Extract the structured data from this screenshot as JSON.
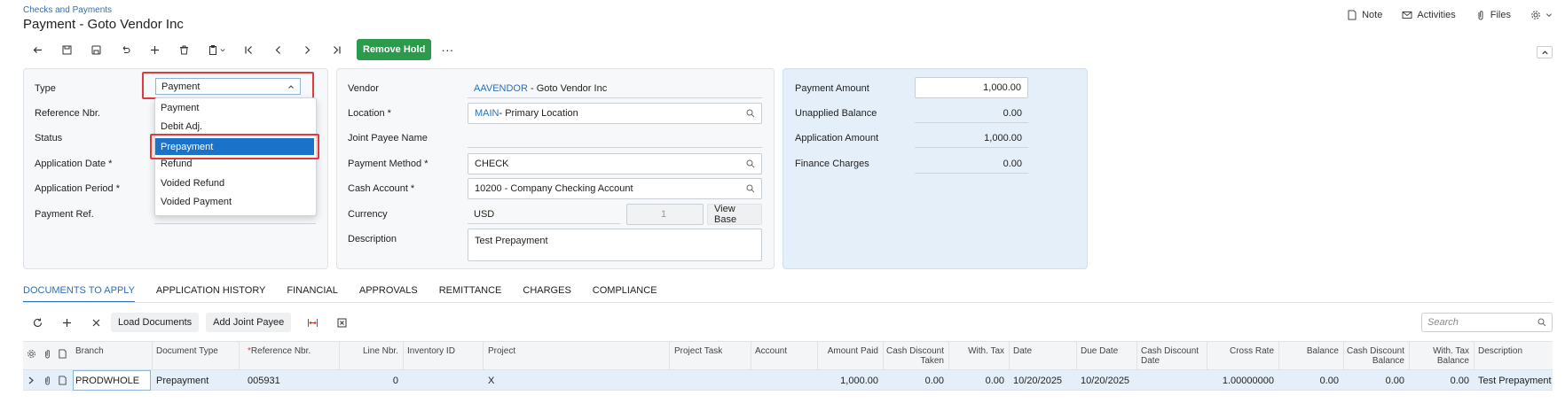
{
  "header": {
    "breadcrumb": "Checks and Payments",
    "title": "Payment - Goto Vendor Inc",
    "actions": {
      "note": "Note",
      "activities": "Activities",
      "files": "Files"
    }
  },
  "toolbar": {
    "remove_hold": "Remove Hold",
    "more": "···"
  },
  "summary_left": {
    "type_label": "Type",
    "type_value": "Payment",
    "reference_label": "Reference Nbr.",
    "status_label": "Status",
    "app_date_label": "Application Date *",
    "app_period_label": "Application Period *",
    "payment_ref_label": "Payment Ref."
  },
  "type_dropdown": {
    "options": [
      "Payment",
      "Debit Adj.",
      "Prepayment",
      "Refund",
      "Voided Refund",
      "Voided Payment"
    ],
    "highlighted": "Prepayment"
  },
  "summary_mid": {
    "vendor_label": "Vendor",
    "vendor_code": "AAVENDOR",
    "vendor_name": " - Goto Vendor Inc",
    "location_label": "Location *",
    "location_code": "MAIN",
    "location_name": " - Primary Location",
    "joint_payee_label": "Joint Payee Name",
    "payment_method_label": "Payment Method *",
    "payment_method": "CHECK",
    "cash_account_label": "Cash Account *",
    "cash_account": "10200 - Company Checking Account",
    "currency_label": "Currency",
    "currency": "USD",
    "currency_rate": "1",
    "view_base": "View Base",
    "description_label": "Description",
    "description": "Test Prepayment"
  },
  "summary_right": {
    "payment_amount_label": "Payment Amount",
    "payment_amount": "1,000.00",
    "unapplied_label": "Unapplied Balance",
    "unapplied": "0.00",
    "application_amount_label": "Application Amount",
    "application_amount": "1,000.00",
    "finance_charges_label": "Finance Charges",
    "finance_charges": "0.00"
  },
  "tabs": [
    "DOCUMENTS TO APPLY",
    "APPLICATION HISTORY",
    "FINANCIAL",
    "APPROVALS",
    "REMITTANCE",
    "CHARGES",
    "COMPLIANCE"
  ],
  "grid_toolbar": {
    "load_documents": "Load Documents",
    "add_joint_payee": "Add Joint Payee",
    "search_placeholder": "Search"
  },
  "grid": {
    "headers": {
      "branch": "Branch",
      "doc_type": "Document Type",
      "ref_nbr": "Reference Nbr.",
      "line_nbr": "Line Nbr.",
      "inventory_id": "Inventory ID",
      "project": "Project",
      "project_task": "Project Task",
      "account": "Account",
      "amount_paid": "Amount Paid",
      "cash_discount_taken_1": "Cash Discount",
      "cash_discount_taken_2": "Taken",
      "with_tax": "With. Tax",
      "date": "Date",
      "due_date": "Due Date",
      "cash_discount_date_1": "Cash Discount",
      "cash_discount_date_2": "Date",
      "cross_rate": "Cross Rate",
      "balance": "Balance",
      "cash_discount_balance_1": "Cash Discount",
      "cash_discount_balance_2": "Balance",
      "with_tax_balance_1": "With. Tax",
      "with_tax_balance_2": "Balance",
      "description": "Description"
    },
    "row": {
      "branch": "PRODWHOLE",
      "doc_type": "Prepayment",
      "ref_nbr": "005931",
      "line_nbr": "0",
      "project": "X",
      "amount_paid": "1,000.00",
      "cash_discount_taken": "0.00",
      "with_tax": "0.00",
      "date": "10/20/2025",
      "due_date": "10/20/2025",
      "cross_rate": "1.00000000",
      "balance": "0.00",
      "cash_discount_balance": "0.00",
      "with_tax_balance": "0.00",
      "description": "Test Prepayment"
    }
  }
}
